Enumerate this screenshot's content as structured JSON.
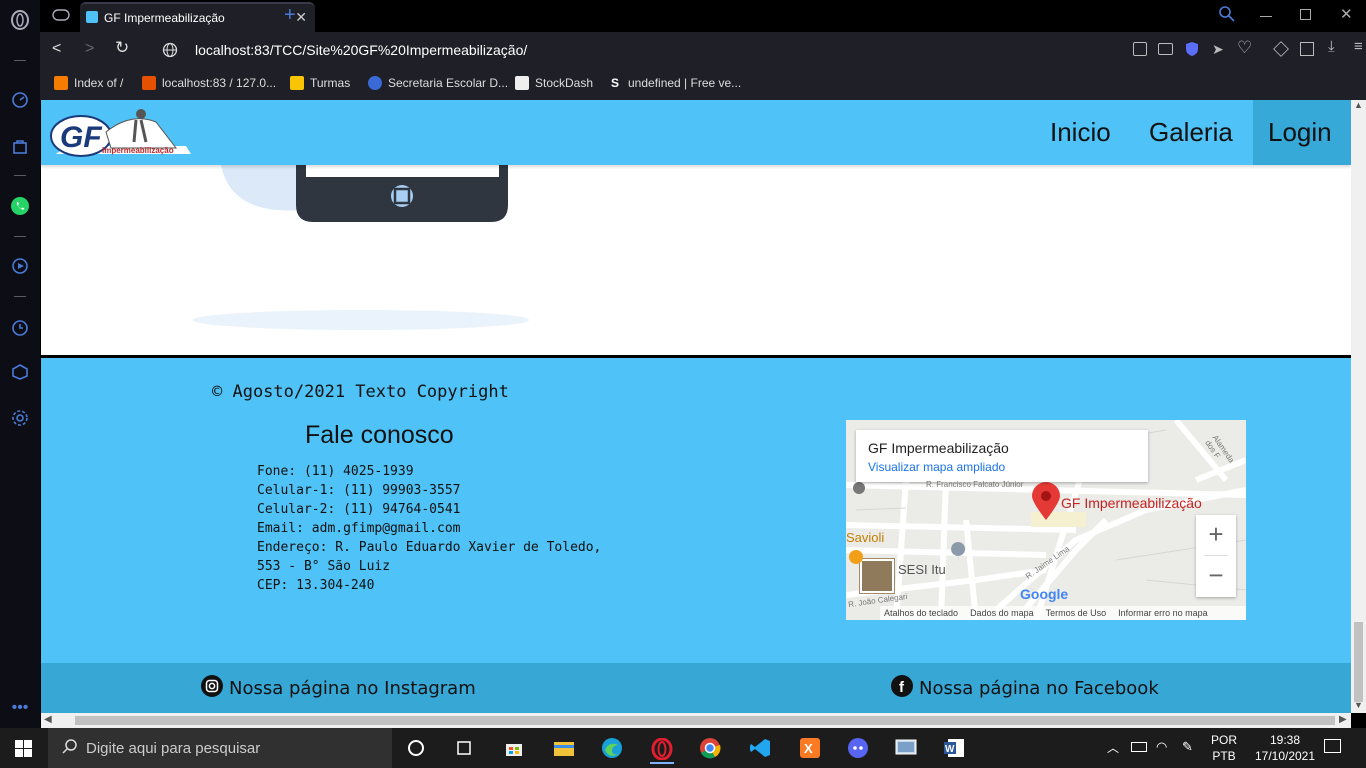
{
  "browser": {
    "tab_title": "GF Impermeabilização",
    "url": "localhost:83/TCC/Site%20GF%20Impermeabilização/",
    "bookmarks": [
      {
        "label": "Index of /"
      },
      {
        "label": "localhost:83 / 127.0..."
      },
      {
        "label": "Turmas"
      },
      {
        "label": "Secretaria Escolar D..."
      },
      {
        "label": "StockDash"
      },
      {
        "label": "undefined | Free ve..."
      }
    ]
  },
  "site": {
    "logo_text": "GF",
    "logo_subtitle": "Impermeabilização",
    "nav": {
      "home": "Inicio",
      "gallery": "Galeria",
      "login": "Login"
    }
  },
  "footer": {
    "copyright": "© Agosto/2021 Texto Copyright",
    "contact_title": "Fale conosco",
    "contact_lines": {
      "phone": "Fone: (11) 4025-1939",
      "cell1": "Celular-1: (11) 99903-3557",
      "cell2": "Celular-2: (11) 94764-0541",
      "email": "Email: adm.gfimp@gmail.com",
      "address": "Endereço: R. Paulo Eduardo Xavier de Toledo, 553 - B° São Luiz",
      "cep": "CEP: 13.304-240"
    },
    "map": {
      "place_name": "GF Impermeabilização",
      "view_larger": "Visualizar mapa ampliado",
      "pin_label": "GF Impermeabilização",
      "poi_savioli": "Savioli",
      "poi_sesi": "SESI Itu",
      "google": "Google",
      "attrib": [
        "Atalhos do teclado",
        "Dados do mapa",
        "Termos de Uso",
        "Informar erro no mapa"
      ],
      "streets": [
        "R. Francisco Falcato Júnior",
        "R. Jaime Lima",
        "R. João Calegari",
        "Alameda dos F"
      ]
    },
    "social": {
      "instagram": "Nossa página no Instagram",
      "facebook": "Nossa página no Facebook"
    }
  },
  "taskbar": {
    "search_placeholder": "Digite aqui para pesquisar",
    "lang_top": "POR",
    "lang_bottom": "PTB",
    "time": "19:38",
    "date": "17/10/2021"
  },
  "colors": {
    "site_blue": "#4fc3f7",
    "site_blue_dark": "#37a7d6",
    "pin_red": "#e53935"
  }
}
